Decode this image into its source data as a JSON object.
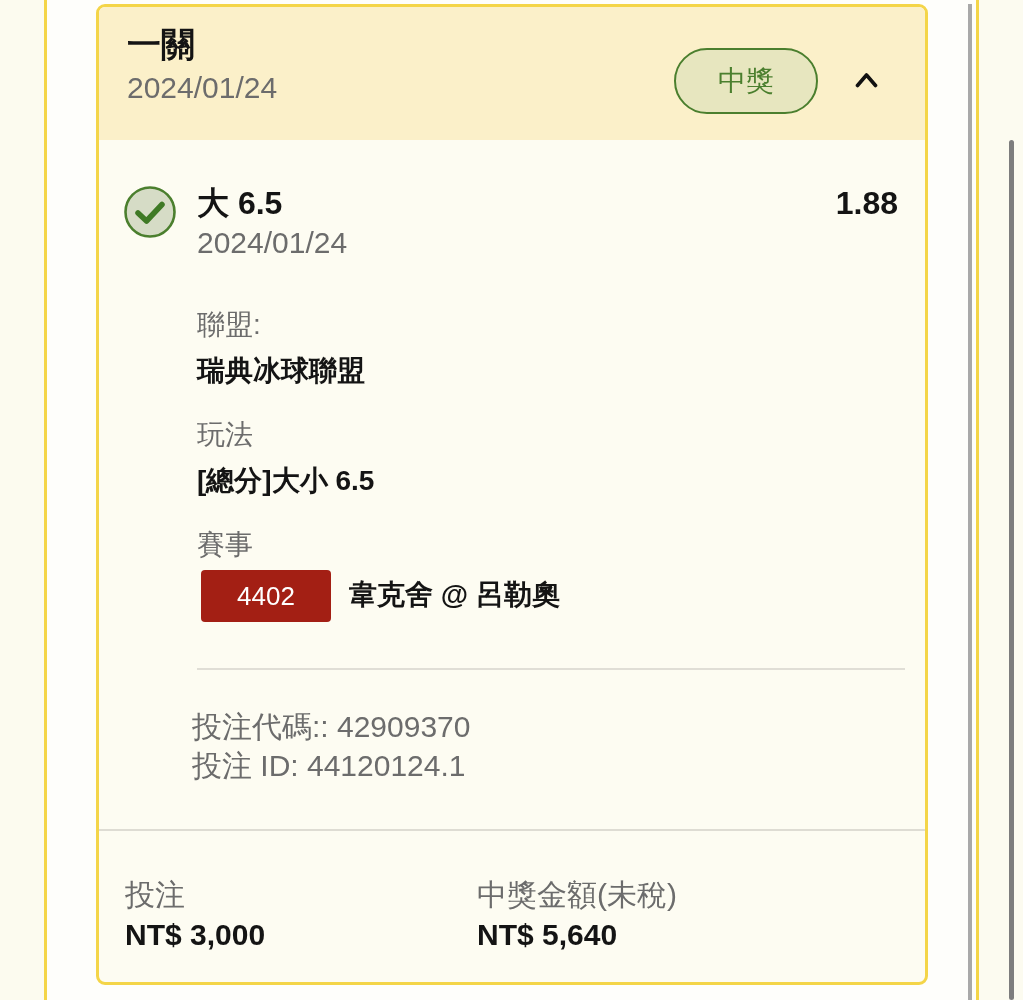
{
  "bet": {
    "title": "一關",
    "date": "2024/01/24",
    "status_badge": "中獎",
    "won": true,
    "expanded": true,
    "selection": {
      "name": "大 6.5",
      "date": "2024/01/24",
      "odds": "1.88",
      "won": true
    },
    "details": [
      {
        "kind": "text",
        "label": "聯盟:",
        "value": "瑞典冰球聯盟"
      },
      {
        "kind": "text",
        "label": "玩法",
        "value": "[總分]大小 6.5"
      },
      {
        "kind": "match",
        "label": "賽事",
        "match_code": "4402",
        "value": "韋克舍 @ 呂勒奧"
      }
    ],
    "references": [
      "投注代碼:: 42909370",
      "投注 ID: 44120124.1"
    ],
    "totals": [
      {
        "label": "投注",
        "value": "NT$ 3,000"
      },
      {
        "label": "中獎金額(未稅)",
        "value": "NT$ 5,640"
      }
    ]
  }
}
